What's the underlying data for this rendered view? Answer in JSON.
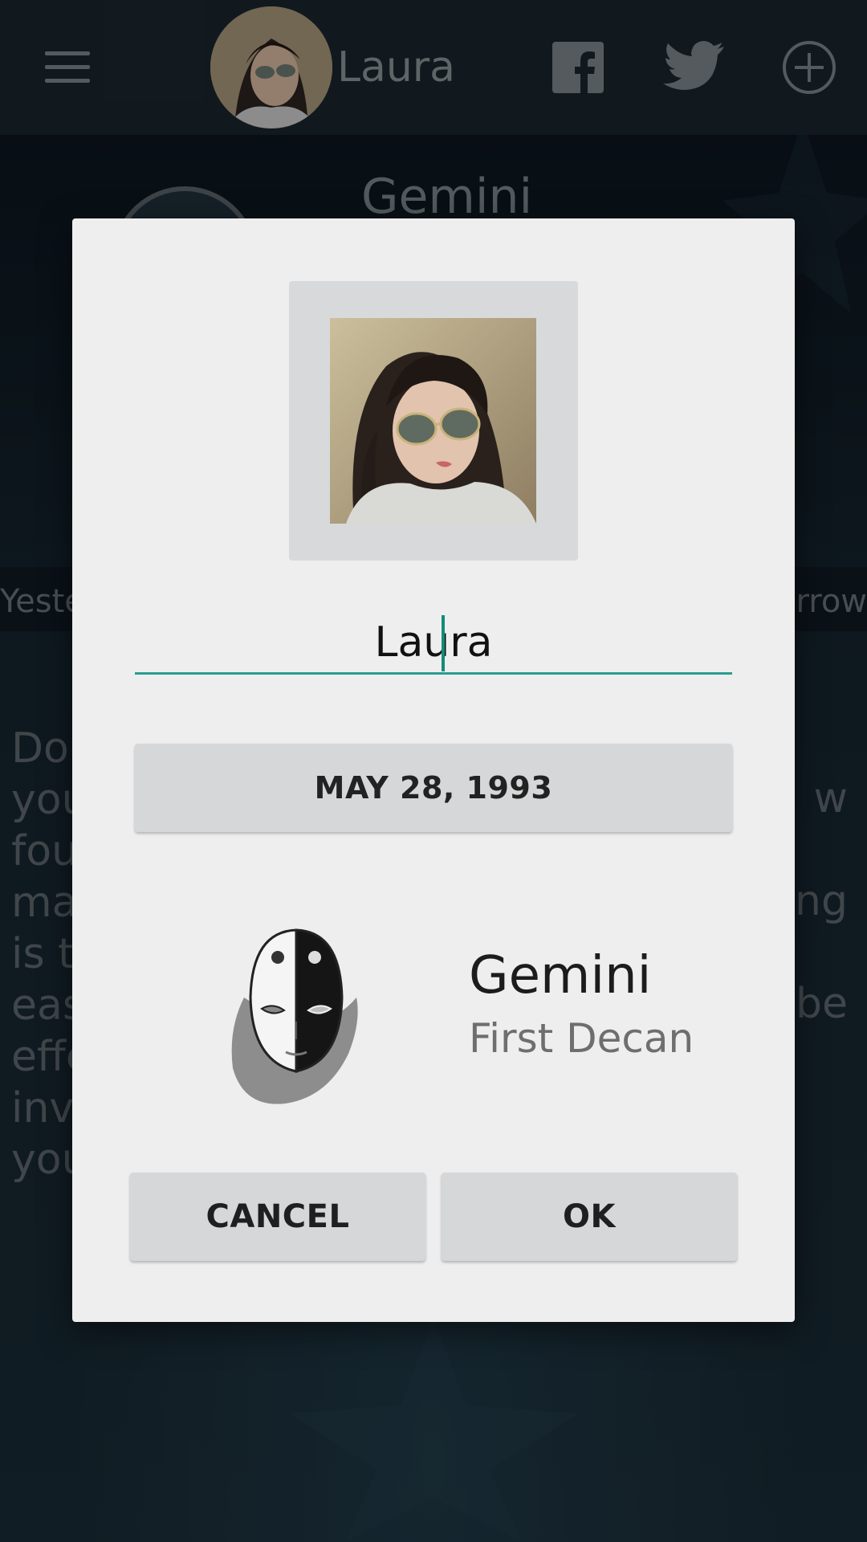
{
  "topbar": {
    "user_name": "Laura",
    "icons": [
      "menu-icon",
      "facebook-icon",
      "twitter-icon",
      "add-circle-icon"
    ]
  },
  "background": {
    "sign_title": "Gemini",
    "nav_left": "Yeste",
    "nav_right": "orrow",
    "text_left": "Dou\nyou\nfou\nma\nis t\neas\neffe\ninve\nyou",
    "text_right": "w\n\nting\n\nbe"
  },
  "dialog": {
    "name_value": "Laura",
    "birth_date": "MAY 28, 1993",
    "sign_name": "Gemini",
    "sign_decan": "First Decan",
    "cancel_label": "CANCEL",
    "ok_label": "OK"
  },
  "colors": {
    "accent": "#2a9d8f",
    "dialog_bg": "#eeeeef",
    "button_bg": "#d6d7d8"
  }
}
